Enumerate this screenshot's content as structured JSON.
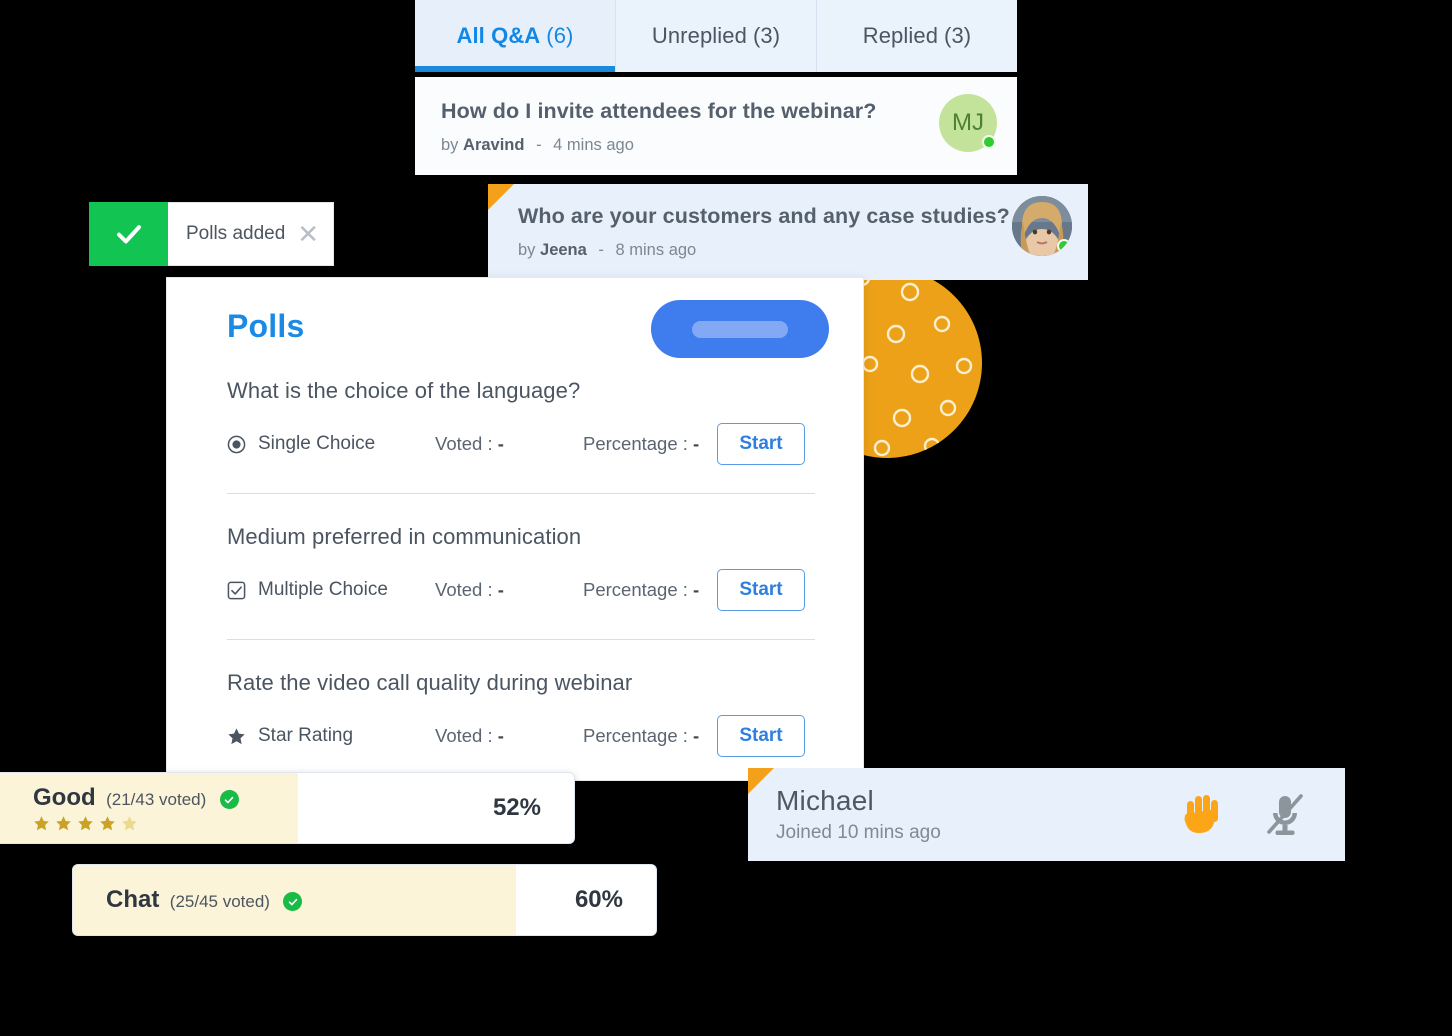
{
  "qa": {
    "tabs": [
      {
        "label": "All Q&A",
        "count": "(6)",
        "active": true
      },
      {
        "label": "Unreplied",
        "count": "(3)",
        "active": false
      },
      {
        "label": "Replied",
        "count": "(3)",
        "active": false
      }
    ],
    "questions": [
      {
        "text": "How do I invite attendees for the webinar?",
        "by_prefix": "by",
        "author": "Aravind",
        "dash": "-",
        "time": "4 mins ago",
        "avatar_initials": "MJ",
        "avatar_type": "initials",
        "status": "online"
      },
      {
        "text": "Who are your customers and any case studies?",
        "by_prefix": "by",
        "author": "Jeena",
        "dash": "-",
        "time": "8 mins ago",
        "avatar_initials": "",
        "avatar_type": "photo",
        "status": "online"
      }
    ]
  },
  "toast": {
    "message": "Polls added",
    "icon": "check-icon",
    "close_icon": "close-icon",
    "accent": "#12c451"
  },
  "polls": {
    "title": "Polls",
    "voted_label": "Voted :",
    "percentage_label": "Percentage :",
    "start_label": "Start",
    "items": [
      {
        "question": "What is the choice of the language?",
        "type": "Single Choice",
        "type_icon": "radio-icon",
        "voted_value": "-",
        "percentage_value": "-"
      },
      {
        "question": "Medium preferred in communication",
        "type": "Multiple Choice",
        "type_icon": "checkbox-icon",
        "voted_value": "-",
        "percentage_value": "-"
      },
      {
        "question": "Rate the video call quality during webinar",
        "type": "Star Rating",
        "type_icon": "star-icon",
        "voted_value": "-",
        "percentage_value": "-"
      }
    ]
  },
  "results": [
    {
      "name": "Good",
      "count": "(21/43 voted)",
      "percent": "52%",
      "fill_ratio": 52,
      "stars_filled": 4,
      "stars_total": 5,
      "verified": true
    },
    {
      "name": "Chat",
      "count": "(25/45 voted)",
      "percent": "60%",
      "fill_ratio": 76,
      "stars_filled": 0,
      "stars_total": 0,
      "verified": true
    }
  ],
  "participant": {
    "name": "Michael",
    "status": "Joined 10 mins ago",
    "hand_icon": "raised-hand-icon",
    "mic_icon": "mic-muted-icon",
    "hand_color": "#fba517",
    "mic_color": "#8d959c"
  },
  "colors": {
    "accent_blue": "#1a8ae5",
    "tab_bg": "#eaf2fb",
    "orange": "#eda118",
    "green": "#12c451",
    "result_fill": "#fbf4d9"
  }
}
